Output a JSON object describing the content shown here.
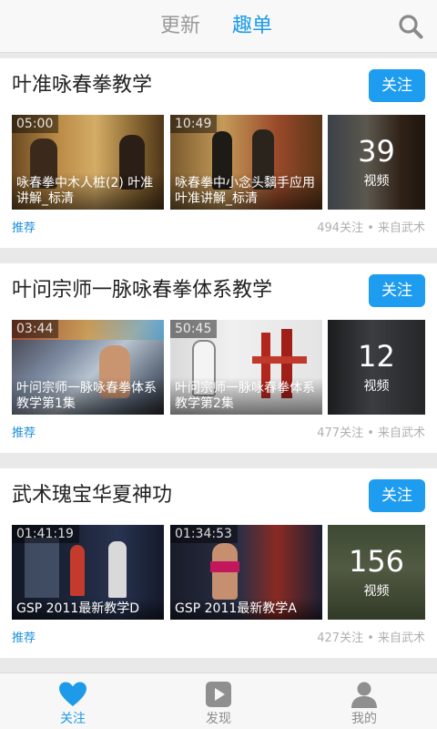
{
  "header": {
    "tabs": [
      {
        "label": "更新",
        "active": false
      },
      {
        "label": "趣单",
        "active": true
      }
    ],
    "search_icon": "search-icon"
  },
  "colors": {
    "accent": "#1d9be8",
    "follow_button": "#1e9cf0",
    "background": "#e9e9e9"
  },
  "cards": [
    {
      "title": "叶准咏春拳教学",
      "follow_label": "关注",
      "videos": [
        {
          "duration": "05:00",
          "caption": "咏春拳中木人桩(2) 叶准讲解_标清"
        },
        {
          "duration": "10:49",
          "caption": "咏春拳中小念头黐手应用 叶准讲解_标清"
        }
      ],
      "video_count": "39",
      "video_unit": "视频",
      "tag": "推荐",
      "meta": "494关注 • 来自武术"
    },
    {
      "title": "叶问宗师一脉咏春拳体系教学",
      "follow_label": "关注",
      "videos": [
        {
          "duration": "03:44",
          "caption": "叶问宗师一脉咏春拳体系教学第1集"
        },
        {
          "duration": "50:45",
          "caption": "叶问宗师一脉咏春拳体系教学第2集"
        }
      ],
      "video_count": "12",
      "video_unit": "视频",
      "tag": "推荐",
      "meta": "477关注 • 来自武术"
    },
    {
      "title": "武术瑰宝华夏神功",
      "follow_label": "关注",
      "videos": [
        {
          "duration": "01:41:19",
          "caption": "GSP 2011最新教学D"
        },
        {
          "duration": "01:34:53",
          "caption": "GSP 2011最新教学A"
        }
      ],
      "video_count": "156",
      "video_unit": "视频",
      "tag": "推荐",
      "meta": "427关注 • 来自武术"
    }
  ],
  "bottom_nav": [
    {
      "label": "关注",
      "icon": "heart-icon",
      "active": true
    },
    {
      "label": "发现",
      "icon": "play-icon",
      "active": false
    },
    {
      "label": "我的",
      "icon": "person-icon",
      "active": false
    }
  ]
}
